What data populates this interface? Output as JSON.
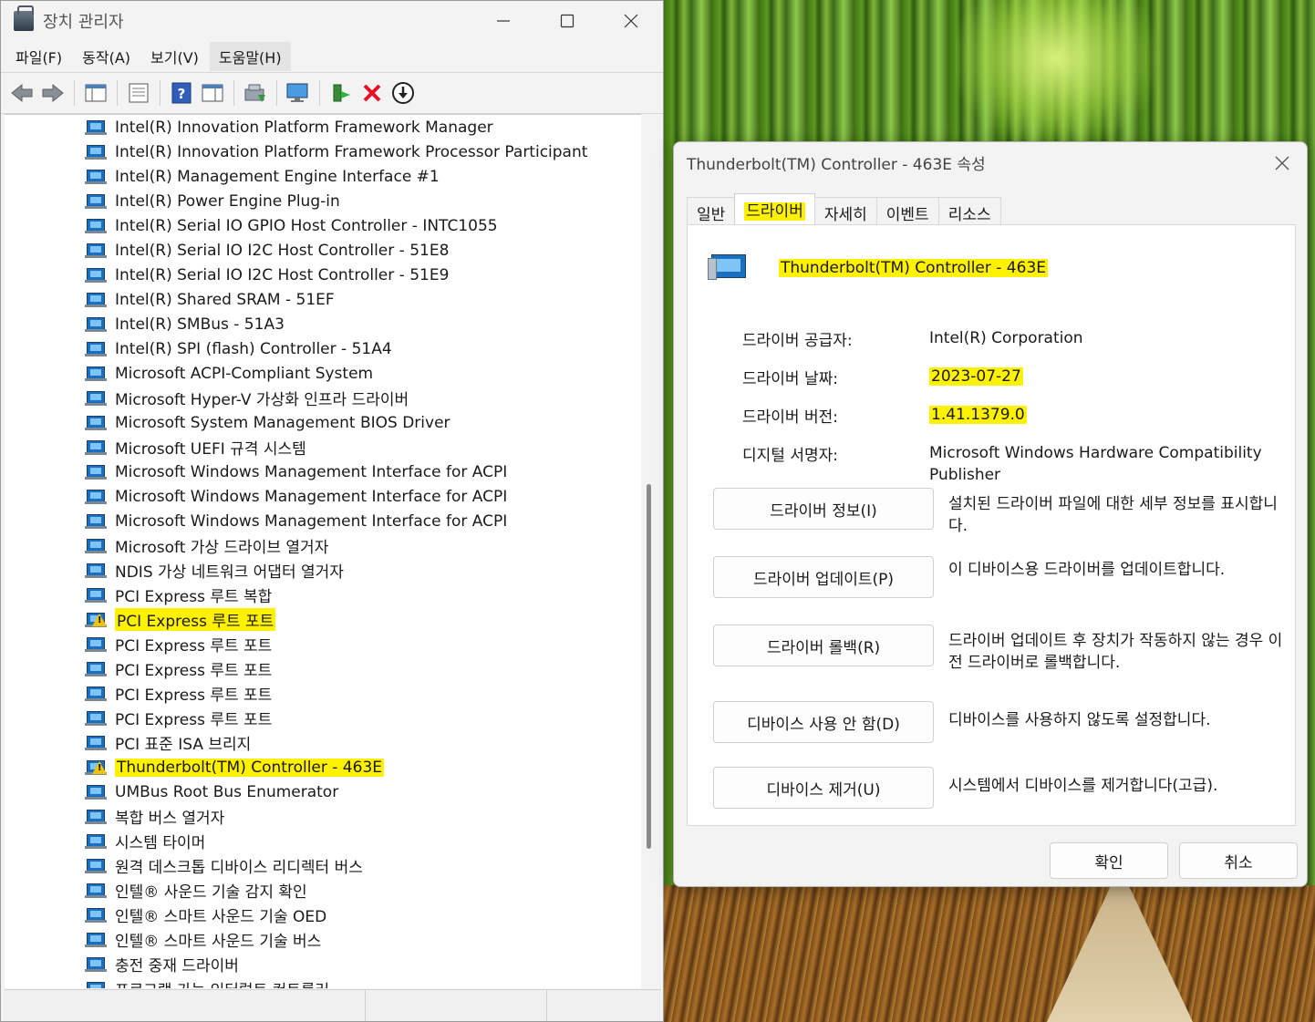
{
  "device_manager": {
    "title": "장치 관리자",
    "menu": [
      "파일(F)",
      "동작(A)",
      "보기(V)",
      "도움말(H)"
    ],
    "devices": [
      {
        "name": "Intel(R) Innovation Platform Framework Manager",
        "warning": false,
        "highlight": false
      },
      {
        "name": "Intel(R) Innovation Platform Framework Processor Participant",
        "warning": false,
        "highlight": false
      },
      {
        "name": "Intel(R) Management Engine Interface #1",
        "warning": false,
        "highlight": false
      },
      {
        "name": "Intel(R) Power Engine Plug-in",
        "warning": false,
        "highlight": false
      },
      {
        "name": "Intel(R) Serial IO GPIO Host Controller - INTC1055",
        "warning": false,
        "highlight": false
      },
      {
        "name": "Intel(R) Serial IO I2C Host Controller - 51E8",
        "warning": false,
        "highlight": false
      },
      {
        "name": "Intel(R) Serial IO I2C Host Controller - 51E9",
        "warning": false,
        "highlight": false
      },
      {
        "name": "Intel(R) Shared SRAM - 51EF",
        "warning": false,
        "highlight": false
      },
      {
        "name": "Intel(R) SMBus - 51A3",
        "warning": false,
        "highlight": false
      },
      {
        "name": "Intel(R) SPI (flash) Controller - 51A4",
        "warning": false,
        "highlight": false
      },
      {
        "name": "Microsoft ACPI-Compliant System",
        "warning": false,
        "highlight": false
      },
      {
        "name": "Microsoft Hyper-V 가상화 인프라 드라이버",
        "warning": false,
        "highlight": false
      },
      {
        "name": "Microsoft System Management BIOS Driver",
        "warning": false,
        "highlight": false
      },
      {
        "name": "Microsoft UEFI 규격 시스템",
        "warning": false,
        "highlight": false
      },
      {
        "name": "Microsoft Windows Management Interface for ACPI",
        "warning": false,
        "highlight": false
      },
      {
        "name": "Microsoft Windows Management Interface for ACPI",
        "warning": false,
        "highlight": false
      },
      {
        "name": "Microsoft Windows Management Interface for ACPI",
        "warning": false,
        "highlight": false
      },
      {
        "name": "Microsoft 가상 드라이브 열거자",
        "warning": false,
        "highlight": false
      },
      {
        "name": "NDIS 가상 네트워크 어댑터 열거자",
        "warning": false,
        "highlight": false
      },
      {
        "name": "PCI Express 루트 복합",
        "warning": false,
        "highlight": false
      },
      {
        "name": "PCI Express 루트 포트",
        "warning": true,
        "highlight": true
      },
      {
        "name": "PCI Express 루트 포트",
        "warning": false,
        "highlight": false
      },
      {
        "name": "PCI Express 루트 포트",
        "warning": false,
        "highlight": false
      },
      {
        "name": "PCI Express 루트 포트",
        "warning": false,
        "highlight": false
      },
      {
        "name": "PCI Express 루트 포트",
        "warning": false,
        "highlight": false
      },
      {
        "name": "PCI 표준 ISA 브리지",
        "warning": false,
        "highlight": false
      },
      {
        "name": "Thunderbolt(TM) Controller - 463E",
        "warning": true,
        "highlight": true
      },
      {
        "name": "UMBus Root Bus Enumerator",
        "warning": false,
        "highlight": false
      },
      {
        "name": "복합 버스 열거자",
        "warning": false,
        "highlight": false
      },
      {
        "name": "시스템 타이머",
        "warning": false,
        "highlight": false
      },
      {
        "name": "원격 데스크톱 디바이스 리디렉터 버스",
        "warning": false,
        "highlight": false
      },
      {
        "name": "인텔® 사운드 기술 감지 확인",
        "warning": false,
        "highlight": false
      },
      {
        "name": "인텔® 스마트 사운드 기술 OED",
        "warning": false,
        "highlight": false
      },
      {
        "name": "인텔® 스마트 사운드 기술 버스",
        "warning": false,
        "highlight": false
      },
      {
        "name": "충전 중재 드라이버",
        "warning": false,
        "highlight": false
      },
      {
        "name": "프로그램 가능 인터럽트 컨트롤러",
        "warning": false,
        "highlight": false
      }
    ]
  },
  "dialog": {
    "title": "Thunderbolt(TM) Controller - 463E 속성",
    "tabs": [
      "일반",
      "드라이버",
      "자세히",
      "이벤트",
      "리소스"
    ],
    "device_name": "Thunderbolt(TM) Controller - 463E",
    "props": [
      {
        "label": "드라이버 공급자:",
        "value": "Intel(R) Corporation",
        "highlight": false
      },
      {
        "label": "드라이버 날짜:",
        "value": "2023-07-27",
        "highlight": true
      },
      {
        "label": "드라이버 버전:",
        "value": "1.41.1379.0",
        "highlight": true
      },
      {
        "label": "디지털 서명자:",
        "value": "Microsoft Windows Hardware Compatibility Publisher",
        "highlight": false
      }
    ],
    "actions": [
      {
        "label": "드라이버 정보(I)",
        "desc": "설치된 드라이버 파일에 대한 세부 정보를 표시합니다."
      },
      {
        "label": "드라이버 업데이트(P)",
        "desc": "이 디바이스용 드라이버를 업데이트합니다."
      },
      {
        "label": "드라이버 롤백(R)",
        "desc": "드라이버 업데이트 후 장치가 작동하지 않는 경우 이전 드라이버로 롤백합니다."
      },
      {
        "label": "디바이스 사용 안 함(D)",
        "desc": "디바이스를 사용하지 않도록 설정합니다."
      },
      {
        "label": "디바이스 제거(U)",
        "desc": "시스템에서 디바이스를 제거합니다(고급)."
      }
    ],
    "ok_label": "확인",
    "cancel_label": "취소"
  },
  "colors": {
    "highlight": "#fff200",
    "warning": "#f0c400",
    "delete": "#e81123"
  }
}
